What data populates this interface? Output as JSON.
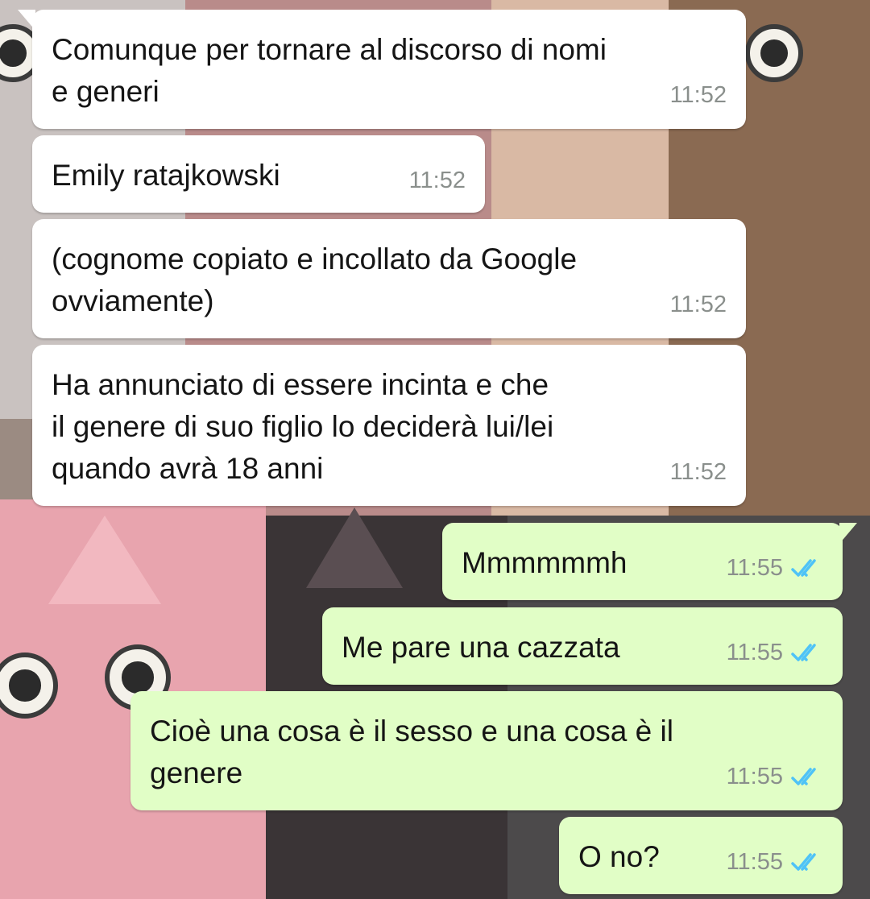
{
  "colors": {
    "incoming_bubble": "#ffffff",
    "outgoing_bubble": "#e1fec6",
    "timestamp": "#8a8f8c",
    "read_ticks": "#4fc3f7"
  },
  "messages": [
    {
      "direction": "in",
      "text": "Comunque per tornare al discorso di nomi\ne generi",
      "time": "11:52"
    },
    {
      "direction": "in",
      "text": "Emily ratajkowski",
      "time": "11:52"
    },
    {
      "direction": "in",
      "text": "(cognome copiato e incollato da Google\novviamente)",
      "time": "11:52"
    },
    {
      "direction": "in",
      "text": "Ha annunciato di essere incinta e che\nil genere di suo figlio lo deciderà lui/lei\nquando avrà 18 anni",
      "time": "11:52"
    },
    {
      "direction": "out",
      "text": "Mmmmmmh",
      "time": "11:55",
      "status_icon": "double-check-read-icon"
    },
    {
      "direction": "out",
      "text": "Me pare una cazzata",
      "time": "11:55",
      "status_icon": "double-check-read-icon"
    },
    {
      "direction": "out",
      "text": "Cioè una cosa è il sesso e una cosa è il\ngenere",
      "time": "11:55",
      "status_icon": "double-check-read-icon"
    },
    {
      "direction": "out",
      "text": "O no?",
      "time": "11:55",
      "status_icon": "double-check-read-icon"
    }
  ]
}
